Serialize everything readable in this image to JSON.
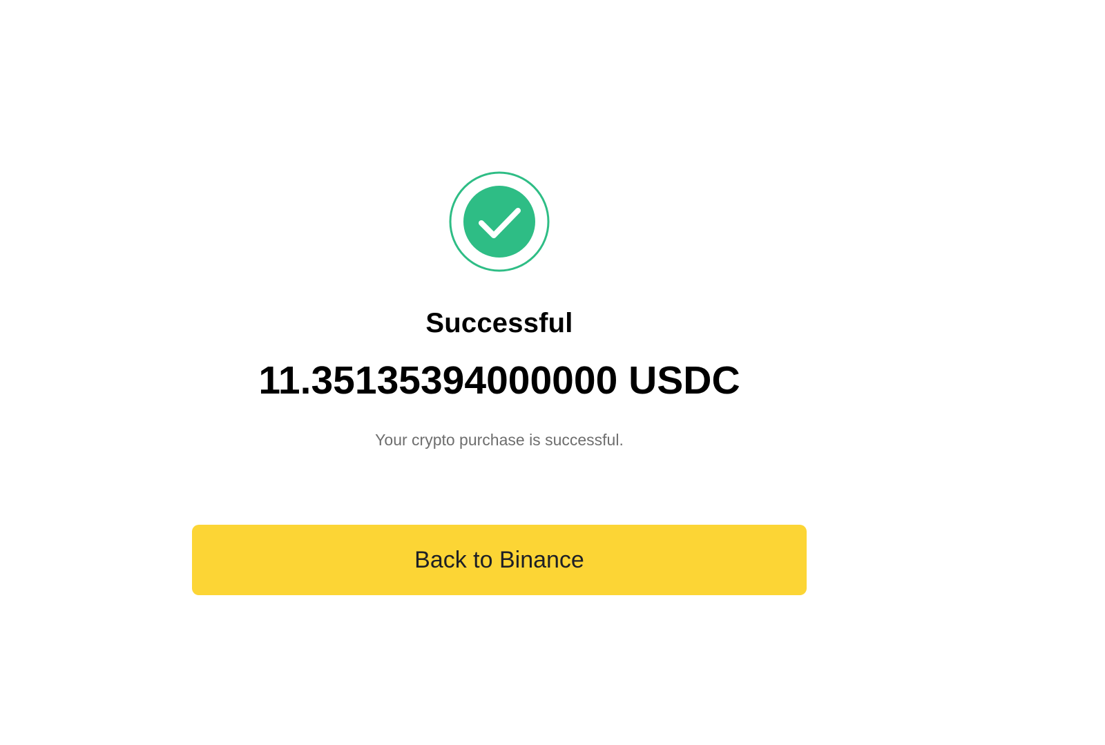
{
  "status": {
    "icon": "check-circle-icon",
    "title": "Successful",
    "amount": "11.35135394000000 USDC",
    "message": "Your crypto purchase is successful."
  },
  "actions": {
    "back_label": "Back to Binance"
  },
  "colors": {
    "success": "#2ebd85",
    "primary_button": "#fcd535",
    "text": "#000000",
    "muted_text": "#6e6e6e"
  }
}
